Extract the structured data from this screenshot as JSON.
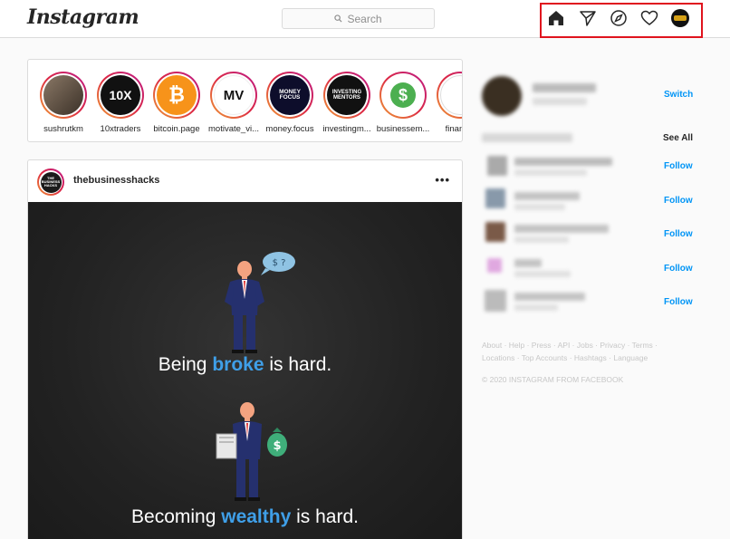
{
  "header": {
    "logo": "Instagram",
    "search_placeholder": "Search",
    "nav_icons": [
      "home-icon",
      "direct-icon",
      "explore-icon",
      "activity-icon",
      "profile-avatar"
    ]
  },
  "stories": [
    {
      "name": "sushrutkm",
      "pic": "",
      "bg": "#6b5a4a"
    },
    {
      "name": "10xtraders",
      "pic": "10X",
      "bg": "#111111"
    },
    {
      "name": "bitcoin.page",
      "pic": "₿",
      "bg": "#f7931a"
    },
    {
      "name": "motivate_vi...",
      "pic": "MV",
      "bg": "#ffffff"
    },
    {
      "name": "money.focus",
      "pic": "MONEY FOCUS",
      "bg": "#0d0d2b"
    },
    {
      "name": "investingm...",
      "pic": "INVESTING MENTORS",
      "bg": "#111111"
    },
    {
      "name": "businessem...",
      "pic": "$",
      "bg": "#ffffff"
    },
    {
      "name": "financia",
      "pic": "",
      "bg": "#ffffff"
    }
  ],
  "post": {
    "username": "thebusinesshacks",
    "avatar_text": "THE BUSINESS HACKS",
    "more": "•••",
    "speech_bubble": "$ ?",
    "caption1_pre": "Being ",
    "caption1_em": "broke",
    "caption1_post": " is hard.",
    "caption2_pre": "Becoming ",
    "caption2_em": "wealthy",
    "caption2_post": " is hard.",
    "accent": "#3f9fe8"
  },
  "sidebar": {
    "switch_label": "Switch",
    "see_all_label": "See All",
    "follow_labels": [
      "Follow",
      "Follow",
      "Follow",
      "Follow",
      "Follow"
    ],
    "footer_links": "About · Help · Press · API · Jobs · Privacy · Terms · Locations · Top Accounts · Hashtags · Language",
    "copyright": "© 2020 INSTAGRAM FROM FACEBOOK"
  },
  "colors": {
    "link_blue": "#0095f6",
    "highlight_red": "#e0141e"
  }
}
